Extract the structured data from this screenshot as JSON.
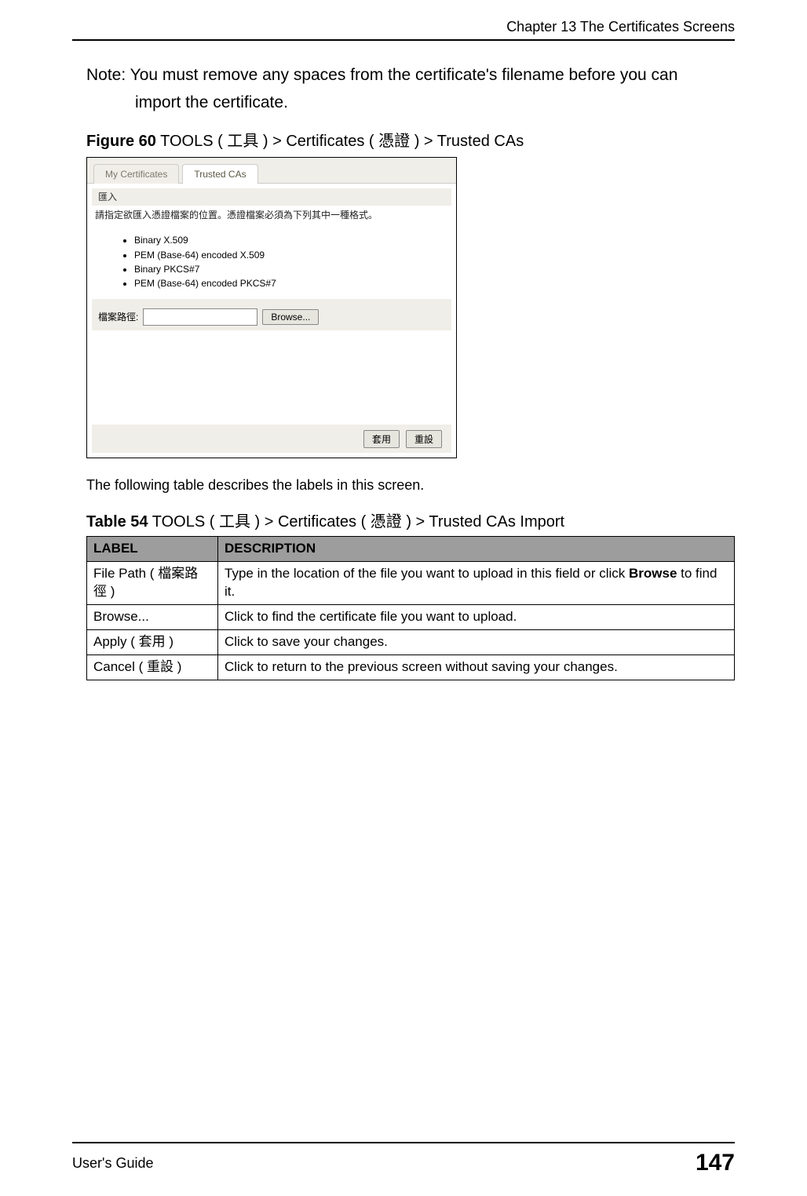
{
  "header": {
    "chapter": "Chapter 13 The Certificates Screens"
  },
  "note": {
    "line1": "Note: You must remove any spaces from the certificate's filename before you can",
    "line2": "import the certificate."
  },
  "figure": {
    "caption_prefix": "Figure 60",
    "caption_sep": "   ",
    "caption_text": "TOOLS ( 工具 ) > Certificates ( 憑證 ) > Trusted CAs",
    "tabs": {
      "inactive": "My Certificates",
      "active": "Trusted CAs"
    },
    "section_header": "匯入",
    "instruction": "請指定欲匯入憑證檔案的位置。憑證檔案必須為下列其中一種格式。",
    "formats": [
      "Binary X.509",
      "PEM (Base-64) encoded X.509",
      "Binary PKCS#7",
      "PEM (Base-64) encoded PKCS#7"
    ],
    "file_path_label": "檔案路徑:",
    "browse_label": "Browse...",
    "apply_label": "套用",
    "cancel_label": "重設"
  },
  "intro": "The following table describes the labels in this screen.",
  "table": {
    "caption_prefix": "Table 54",
    "caption_sep": "   ",
    "caption_text": "TOOLS ( 工具 ) > Certificates ( 憑證 ) > Trusted CAs Import",
    "head": {
      "c1": "LABEL",
      "c2": "DESCRIPTION"
    },
    "rows": [
      {
        "label": "File Path ( 檔案路徑 )",
        "desc_prefix": "Type in the location of the file you want to upload in this field or click ",
        "desc_bold": "Browse",
        "desc_suffix": " to find it."
      },
      {
        "label": "Browse...",
        "desc_prefix": "Click to find the certificate file you want to upload.",
        "desc_bold": "",
        "desc_suffix": ""
      },
      {
        "label": "Apply ( 套用 )",
        "desc_prefix": "Click to save your changes.",
        "desc_bold": "",
        "desc_suffix": ""
      },
      {
        "label": "Cancel ( 重設 )",
        "desc_prefix": "Click to return to the previous screen without saving your changes.",
        "desc_bold": "",
        "desc_suffix": ""
      }
    ]
  },
  "footer": {
    "guide": "User's Guide",
    "page": "147"
  }
}
